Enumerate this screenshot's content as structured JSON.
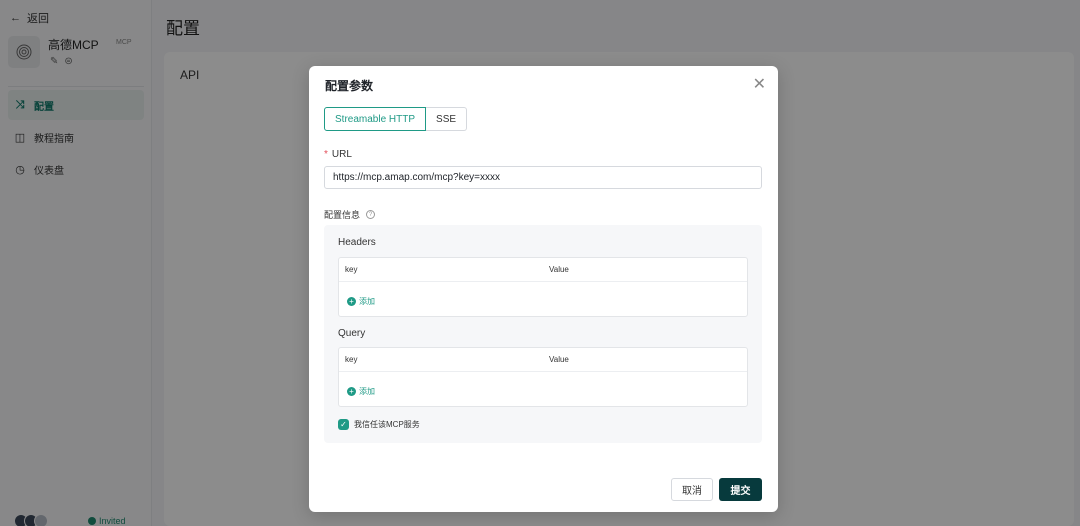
{
  "sidebar": {
    "back_label": "返回",
    "app_name": "高德MCP",
    "app_tag": "MCP",
    "nav": [
      {
        "label": "配置",
        "icon": "shuffle-icon",
        "glyph": "⤨"
      },
      {
        "label": "教程指南",
        "icon": "book-icon",
        "glyph": "◫"
      },
      {
        "label": "仪表盘",
        "icon": "dashboard-icon",
        "glyph": "◷"
      }
    ],
    "invited_label": "Invited"
  },
  "main": {
    "page_title": "配置",
    "section_label": "API"
  },
  "modal": {
    "title": "配置参数",
    "tabs": [
      "Streamable HTTP",
      "SSE"
    ],
    "url_label": "URL",
    "url_value": "https://mcp.amap.com/mcp?key=xxxx",
    "config_label": "配置信息",
    "headers": {
      "title": "Headers",
      "key_col": "key",
      "value_col": "Value",
      "add_label": "添加"
    },
    "query": {
      "title": "Query",
      "key_col": "key",
      "value_col": "Value",
      "add_label": "添加"
    },
    "trust_label": "我信任该MCP服务",
    "cancel_label": "取消",
    "submit_label": "提交"
  },
  "colors": {
    "accent": "#1f9a86",
    "submit_bg": "#073a3d",
    "required": "#e34d59"
  }
}
